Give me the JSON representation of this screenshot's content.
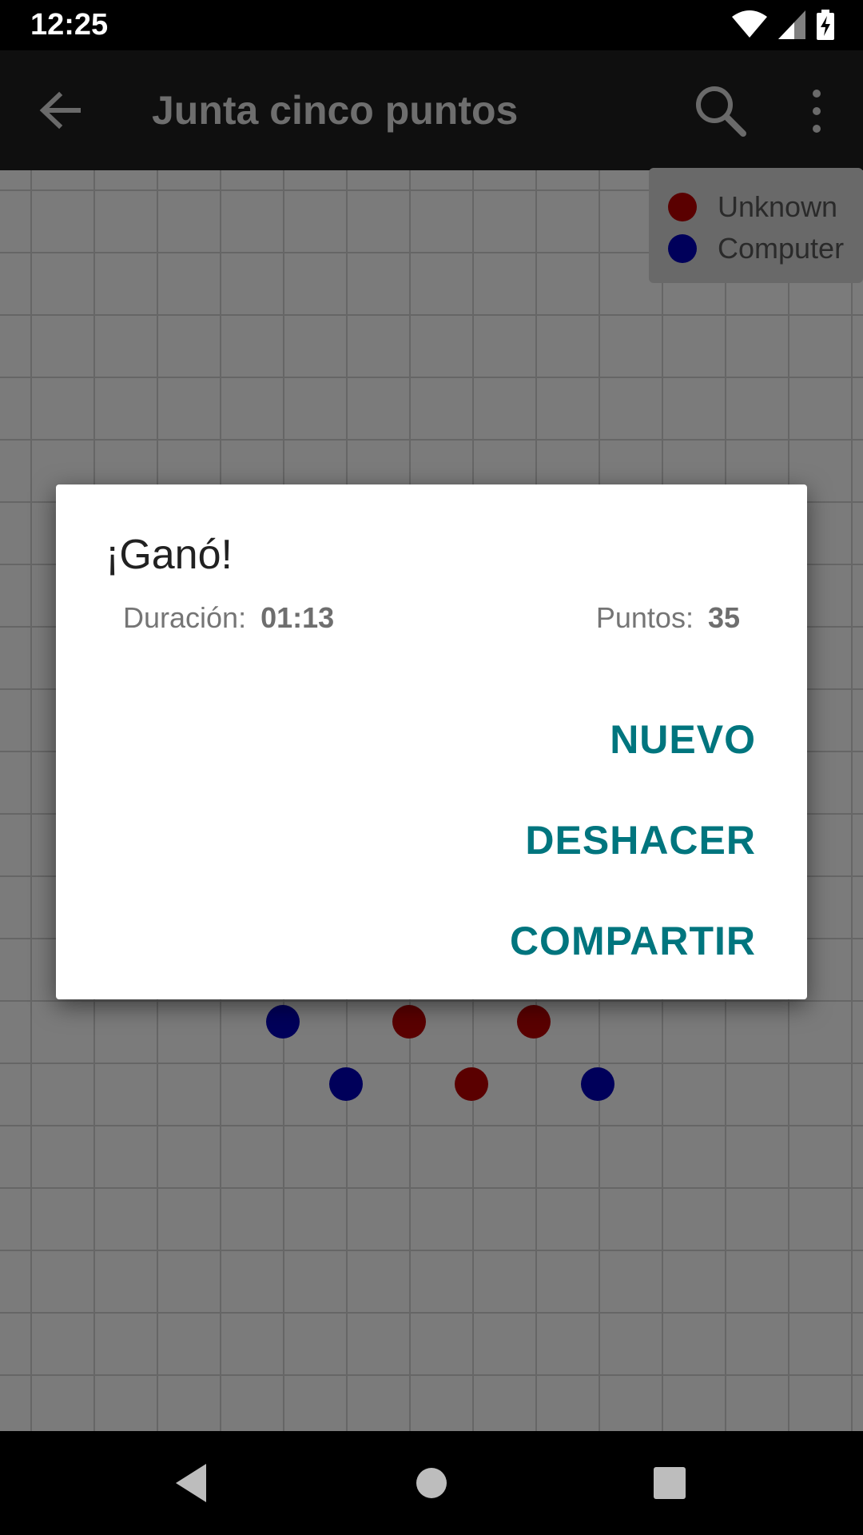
{
  "status_bar": {
    "time": "12:25",
    "icons": [
      "wifi-icon",
      "signal-icon",
      "battery-charging-icon"
    ]
  },
  "app_bar": {
    "title": "Junta cinco puntos",
    "icons": [
      "back-arrow-icon",
      "search-icon",
      "more-vert-icon"
    ]
  },
  "legend": {
    "players": [
      {
        "name": "Unknown",
        "color": "#8b0000"
      },
      {
        "name": "Computer",
        "color": "#00008b"
      }
    ]
  },
  "dialog": {
    "title": "¡Ganó!",
    "duration_label": "Duración:",
    "duration_value": "01:13",
    "points_label": "Puntos:",
    "points_value": "35",
    "buttons": {
      "new": "NUEVO",
      "undo": "DESHACER",
      "share": "COMPARTIR"
    }
  },
  "colors": {
    "accent": "#00757e",
    "player_red": "#8b0000",
    "player_blue": "#00008b"
  },
  "nav_bar": {
    "icons": [
      "back-triangle-icon",
      "home-circle-icon",
      "recents-square-icon"
    ]
  }
}
